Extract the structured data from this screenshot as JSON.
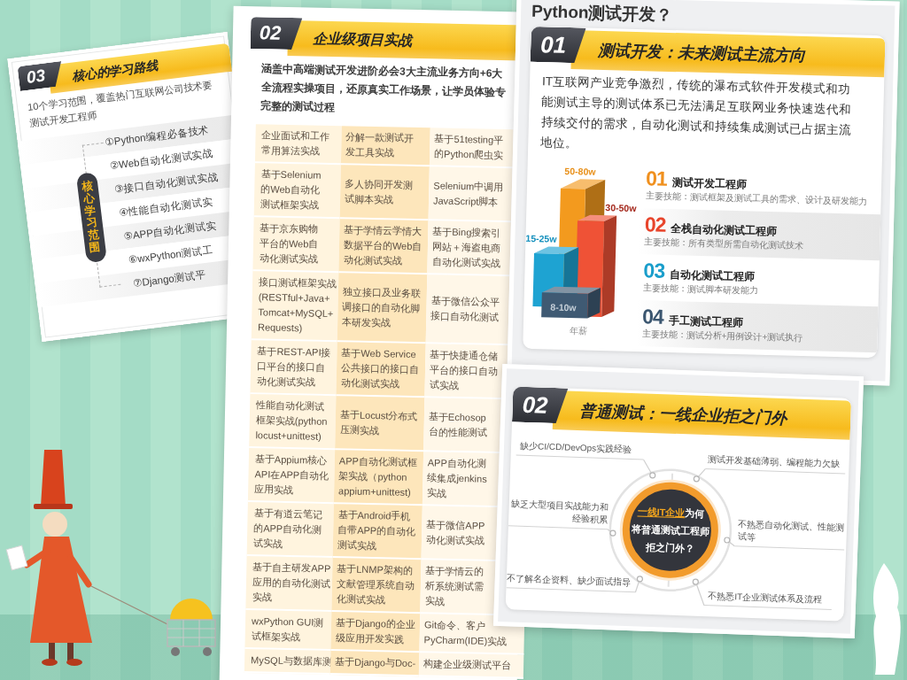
{
  "left_card": {
    "number": "03",
    "title": "核心的学习路线",
    "intro_lines": [
      "10个学习范围，覆盖热门互联网公司技术要",
      "测试开发工程师"
    ],
    "badge": "核心学习范围",
    "topics": [
      "①Python编程必备技术",
      "②Web自动化测试实战",
      "③接口自动化测试实战",
      "④性能自动化测试实",
      "⑤APP自动化测试实",
      "⑥wxPython测试工",
      "⑦Django测试平"
    ]
  },
  "middle_card": {
    "number": "02",
    "title": "企业级项目实战",
    "intro_lines": [
      "涵盖中高端测试开发进阶必会3大主流业务方向+6大",
      "全流程实操项目，还原真实工作场景，让学员体验专",
      "完整的测试过程"
    ],
    "project_table": {
      "rows": [
        {
          "cells": [
            [
              "企业面试和工作",
              "常用算法实战"
            ],
            [
              "分解一款测试开",
              "发工具实战"
            ],
            [
              "基于51testing平",
              "的Python爬虫实"
            ]
          ]
        },
        {
          "cells": [
            [
              "基于Selenium",
              "的Web自动化",
              "测试框架实战"
            ],
            [
              "多人协同开发测",
              "试脚本实战"
            ],
            [
              "Selenium中调用",
              "JavaScript脚本"
            ]
          ]
        },
        {
          "cells": [
            [
              "基于京东购物",
              "平台的Web自",
              "动化测试实战"
            ],
            [
              "基于学情云学情大",
              "数据平台的Web自",
              "动化测试实战"
            ],
            [
              "基于Bing搜索引",
              "网站＋海盗电商",
              "自动化测试实战"
            ]
          ]
        },
        {
          "cells": [
            [
              "接口测试框架实战",
              "(RESTful+Java+",
              "Tomcat+MySQL+",
              "Requests)"
            ],
            [
              "独立接口及业务联",
              "调接口的自动化脚",
              "本研发实战"
            ],
            [
              "基于微信公众平",
              "接口自动化测试"
            ]
          ]
        },
        {
          "cells": [
            [
              "基于REST-API接",
              "口平台的接口自",
              "动化测试实战"
            ],
            [
              "基于Web Service",
              "公共接口的接口自",
              "动化测试实战"
            ],
            [
              "基于快捷通仓储",
              "平台的接口自动",
              "试实战"
            ]
          ]
        },
        {
          "cells": [
            [
              "性能自动化测试",
              "框架实战(python",
              "locust+unittest)"
            ],
            [
              "基于Locust分布式",
              "压测实战"
            ],
            [
              "基于Echosop",
              "台的性能测试"
            ]
          ]
        },
        {
          "cells": [
            [
              "基于Appium核心",
              "API在APP自动化",
              "应用实战"
            ],
            [
              "APP自动化测试框",
              "架实战（python",
              "appium+unittest)"
            ],
            [
              "APP自动化测",
              "续集成jenkins",
              "实战"
            ]
          ]
        },
        {
          "cells": [
            [
              "基于有道云笔记",
              "的APP自动化测",
              "试实战"
            ],
            [
              "基于Android手机",
              "自带APP的自动化",
              "测试实战"
            ],
            [
              "基于微信APP",
              "动化测试实战"
            ]
          ]
        },
        {
          "cells": [
            [
              "基于自主研发APP",
              "应用的自动化测试",
              "实战"
            ],
            [
              "基于LNMP架构的",
              "文献管理系统自动",
              "化测试实战"
            ],
            [
              "基于学情云的",
              "析系统测试需",
              "实战"
            ]
          ]
        },
        {
          "cells": [
            [
              "wxPython GUI测",
              "试框架实战"
            ],
            [
              "基于Django的企业",
              "级应用开发实践"
            ],
            [
              "Git命令、客户",
              "PyCharm(IDE)实战"
            ]
          ]
        },
        {
          "cells": [
            [
              "MySQL与数据库测"
            ],
            [
              "基于Django与Doc-"
            ],
            [
              "构建企业级测试平台"
            ]
          ]
        }
      ]
    }
  },
  "right_card": {
    "heading": "Python测试开发？",
    "career_panel": {
      "number": "01",
      "title": "测试开发：未来测试主流方向",
      "description": "IT互联网产业竞争激烈，传统的瀑布式软件开发模式和功能测试主导的测试体系已无法满足互联网业务快速迭代和持续交付的需求，自动化测试和持续集成测试已占据主流地位。",
      "salary_chart": {
        "segments": [
          {
            "label": "50-80w",
            "color": "#f39a1e"
          },
          {
            "label": "30-50w",
            "color": "#ef5236"
          },
          {
            "label": "15-25w",
            "color": "#1ea3d2"
          },
          {
            "label": "8-10w",
            "color": "#3f5a73"
          }
        ],
        "caption": "年薪"
      },
      "roles": [
        {
          "number": "01",
          "title": "测试开发工程师",
          "skill": "主要技能：测试框架及测试工具的需求、设计及研发能力",
          "color": "#f0901e"
        },
        {
          "number": "02",
          "title": "全栈自动化测试工程师",
          "skill": "主要技能：所有类型所需自动化测试技术",
          "color": "#e8452c"
        },
        {
          "number": "03",
          "title": "自动化测试工程师",
          "skill": "主要技能：测试脚本研发能力",
          "color": "#1a9ecb"
        },
        {
          "number": "04",
          "title": "手工测试工程师",
          "skill": "主要技能：测试分析+用例设计+测试执行",
          "color": "#3b5670"
        }
      ]
    },
    "barrier_panel": {
      "number": "02",
      "title": "普通测试：一线企业拒之门外",
      "center_lines": [
        "**一线IT企业**为何",
        "将普通测试工程师",
        "拒之门外？"
      ],
      "callouts": [
        "缺少CI/CD/DevOps实践经验",
        "测试开发基础薄弱、编程能力欠缺",
        "缺乏大型项目实战能力和经验积累",
        "不熟悉自动化测试、性能测试等",
        "不了解名企资料、缺少面试指导",
        "不熟悉IT企业测试体系及流程"
      ]
    }
  }
}
